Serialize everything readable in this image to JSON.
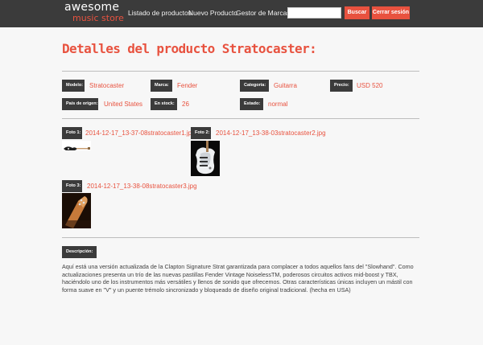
{
  "header": {
    "logo_line1": "awesome",
    "logo_line2": "music store",
    "nav": [
      "Listado de productos",
      "Nuevo Producto",
      "Gestor de Marcas"
    ],
    "search_value": "",
    "search_button": "Buscar",
    "logout_button": "Cerrar sesión"
  },
  "page_title": "Detalles del producto Stratocaster:",
  "fields": {
    "modelo": {
      "label": "Modelo:",
      "value": "Stratocaster"
    },
    "marca": {
      "label": "Marca:",
      "value": "Fender"
    },
    "categoria": {
      "label": "Categoría:",
      "value": "Guitarra"
    },
    "precio": {
      "label": "Precio:",
      "value": "USD 520"
    },
    "pais": {
      "label": "País de origen:",
      "value": "United States"
    },
    "stock": {
      "label": "En stock:",
      "value": "26"
    },
    "estado": {
      "label": "Estado:",
      "value": "normal"
    }
  },
  "photos": [
    {
      "label": "Foto 1:",
      "file": "2014-12-17_13-37-08stratocaster1.jpg"
    },
    {
      "label": "Foto 2:",
      "file": "2014-12-17_13-38-03stratocaster2.jpg"
    },
    {
      "label": "Foto 3:",
      "file": "2014-12-17_13-38-08stratocaster3.jpg"
    }
  ],
  "description": {
    "label": "Descripción:",
    "text": "Aquí está una versión actualizada de la Clapton Signature Strat garantizada para complacer a todos aquellos fans del \"Slowhand\". Como actualizaciones presenta un trío de las nuevas pastillas Fender Vintage NoiselessTM, poderosos circuitos activos mid-boost y TBX, haciéndolo uno de los instrumentos más versátiles y llenos de sonido que ofrecemos. Otras características únicas incluyen un mástil con forma suave en \"V\" y un puente trémolo sincronizado y bloqueado de diseño original tradicional. (hecha en USA)"
  },
  "colors": {
    "accent": "#e8523f",
    "dark": "#3b3b3b",
    "background": "#f7f7f7"
  }
}
